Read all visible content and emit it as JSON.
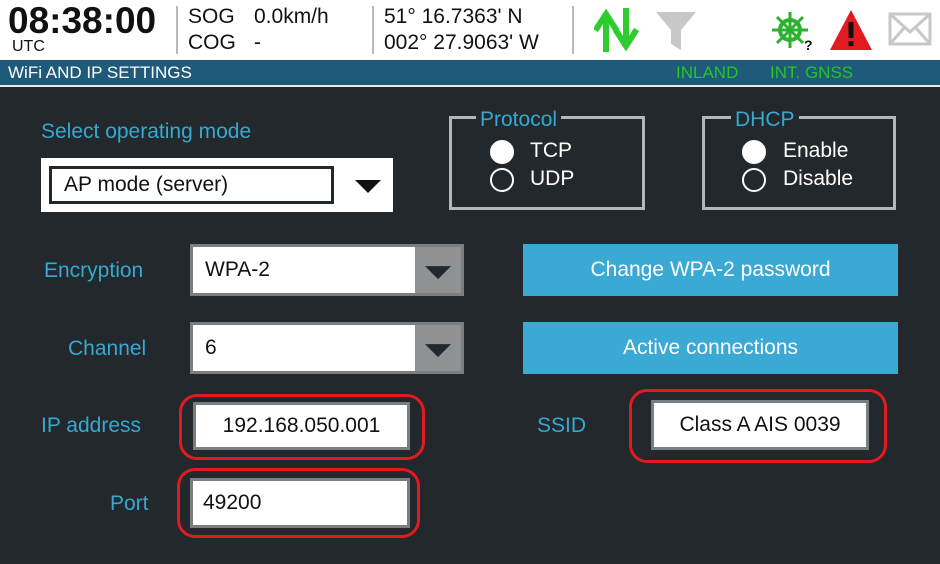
{
  "header": {
    "time": "08:38:00",
    "timezone": "UTC",
    "sog_label": "SOG",
    "sog_value": "0.0km/h",
    "cog_label": "COG",
    "cog_value": "-",
    "latitude": "51° 16.7363' N",
    "longitude": "002° 27.9063' W",
    "icons": [
      "tx-rx-arrows-icon",
      "filter-icon",
      "ship-wheel-icon",
      "alarm-warning-icon",
      "message-envelope-icon"
    ],
    "colors": {
      "arrows": "#2ecc2e",
      "warning": "#e21a22",
      "wheel": "#2bb12b"
    }
  },
  "titlebar": {
    "title": "WiFi AND IP SETTINGS",
    "status_inland": "INLAND",
    "status_gnss": "INT. GNSS"
  },
  "mode": {
    "label": "Select operating mode",
    "value": "AP mode (server)"
  },
  "protocol": {
    "legend": "Protocol",
    "options": [
      "TCP",
      "UDP"
    ],
    "selected": "TCP"
  },
  "dhcp": {
    "legend": "DHCP",
    "options": [
      "Enable",
      "Disable"
    ],
    "selected": "Enable"
  },
  "encryption": {
    "label": "Encryption",
    "value": "WPA-2"
  },
  "channel": {
    "label": "Channel",
    "value": "6"
  },
  "buttons": {
    "change_password": "Change WPA-2 password",
    "active_connections": "Active connections"
  },
  "ip": {
    "label": "IP address",
    "value": "192.168.050.001"
  },
  "port": {
    "label": "Port",
    "value": "49200"
  },
  "ssid": {
    "label": "SSID",
    "value": "Class A AIS 0039"
  }
}
